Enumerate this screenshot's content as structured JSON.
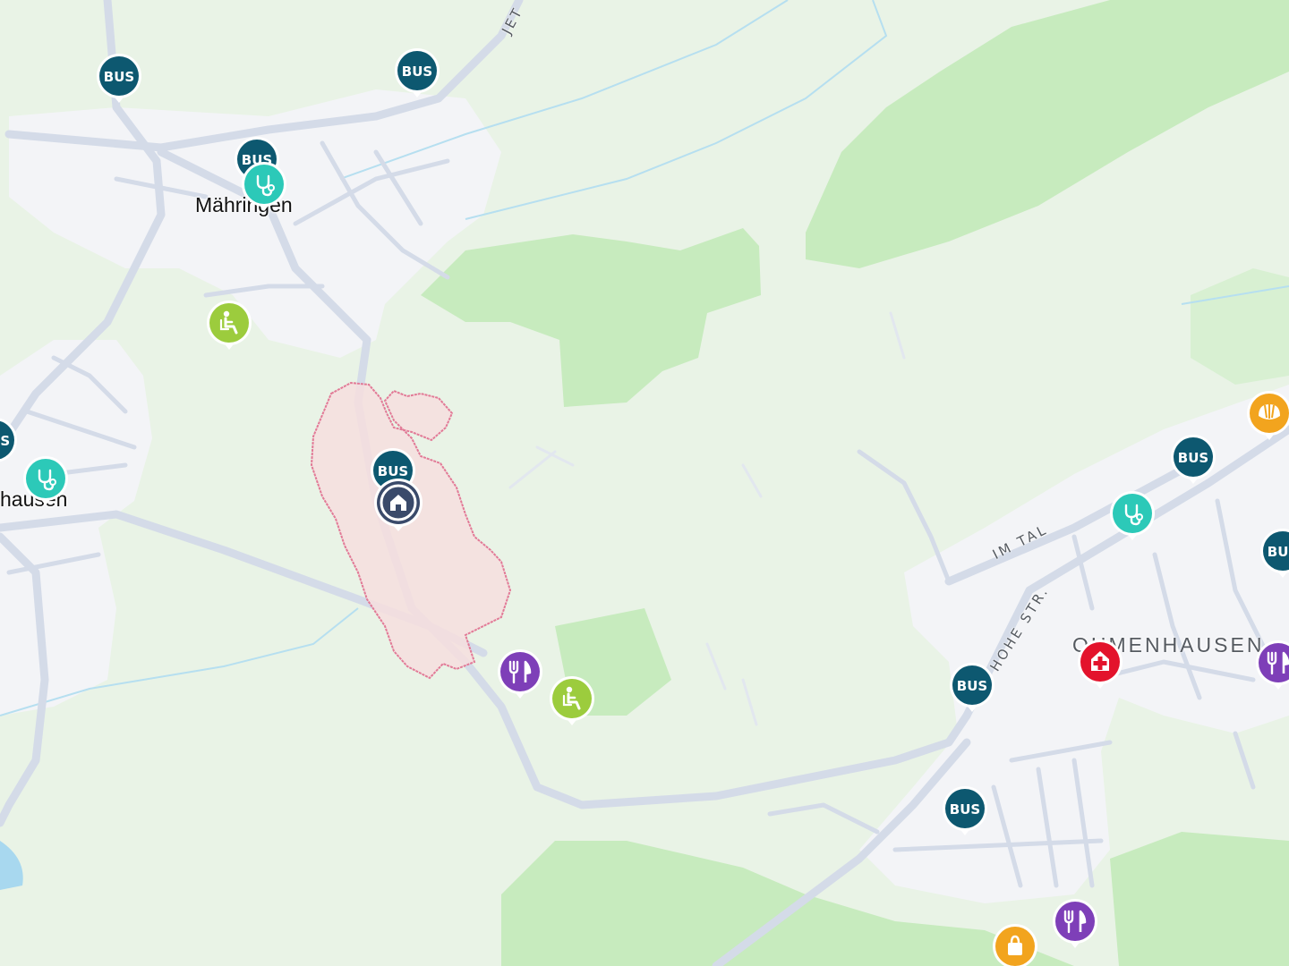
{
  "map": {
    "colors": {
      "land": "#e9f3e6",
      "forest": "#c7ebbe",
      "urban": "#f3f4f7",
      "road": "#d4dbe8",
      "water": "#b6dff0",
      "area_fill": "#f6dede",
      "area_border": "#e27a97"
    },
    "places": {
      "maehringen": "Mähringen",
      "left_village": "hausen",
      "district": "OHMENHAUSEN"
    },
    "streets": {
      "im_tal": "IM TAL",
      "hohe_str": "HOHE STR.",
      "top": "JET"
    },
    "pin_labels": {
      "bus": "BUS"
    },
    "pin_types": {
      "bus": {
        "color": "#0d5870",
        "icon": "bus-text"
      },
      "doctor": {
        "color": "#2cc9b8",
        "icon": "stethoscope-icon"
      },
      "nursing": {
        "color": "#9ccc3d",
        "icon": "seated-person-icon"
      },
      "restaurant": {
        "color": "#7e3fb8",
        "icon": "fork-knife-icon"
      },
      "pharmacy": {
        "color": "#e3132c",
        "icon": "pharmacy-icon"
      },
      "bakery": {
        "color": "#f2a41e",
        "icon": "croissant-icon"
      },
      "shopping": {
        "color": "#f2a41e",
        "icon": "shopping-icon"
      },
      "home": {
        "color": "#3a4a6a",
        "icon": "home-icon"
      }
    }
  }
}
